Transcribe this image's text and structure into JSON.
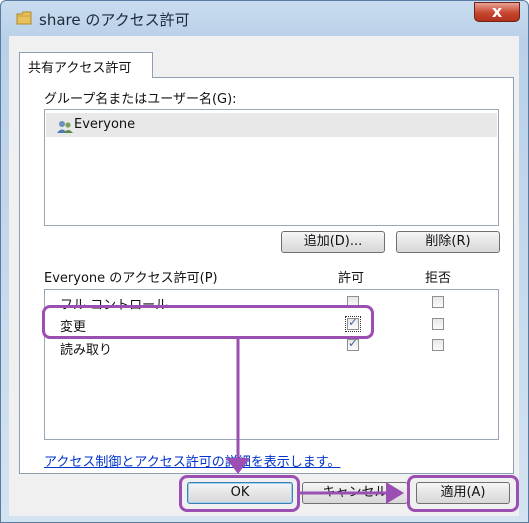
{
  "window": {
    "title": "share のアクセス許可",
    "close_label": "x"
  },
  "tab": {
    "label": "共有アクセス許可"
  },
  "groups": {
    "label": "グループ名またはユーザー名(G):",
    "items": [
      "Everyone"
    ]
  },
  "buttons": {
    "add": "追加(D)...",
    "remove": "削除(R)",
    "ok": "OK",
    "cancel": "キャンセル",
    "apply": "適用(A)"
  },
  "permissions": {
    "label": "Everyone のアクセス許可(P)",
    "allow_header": "許可",
    "deny_header": "拒否",
    "rows": [
      {
        "name": "フル コントロール",
        "allow": false,
        "deny": false
      },
      {
        "name": "変更",
        "allow": true,
        "deny": false
      },
      {
        "name": "読み取り",
        "allow": true,
        "deny": false
      }
    ]
  },
  "link": "アクセス制御とアクセス許可の詳細を表示します。",
  "colors": {
    "highlight": "#9b4fb3",
    "link": "#0033cc"
  }
}
